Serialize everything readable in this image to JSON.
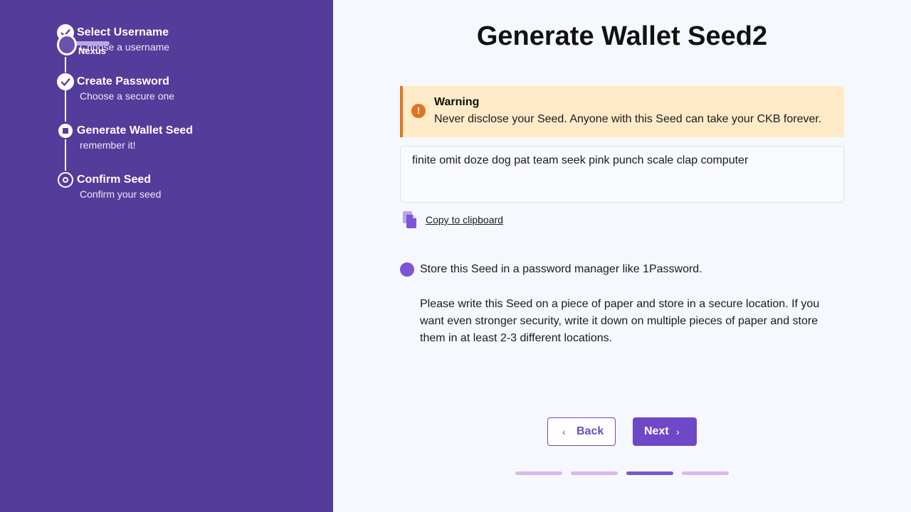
{
  "logo": {
    "word": "Nexus"
  },
  "steps": [
    {
      "title": "Select Username",
      "subtitle": "Choose a username",
      "state": "done"
    },
    {
      "title": "Create Password",
      "subtitle": "Choose a secure one",
      "state": "done"
    },
    {
      "title": "Generate Wallet Seed",
      "subtitle": "remember it!",
      "state": "current"
    },
    {
      "title": "Confirm Seed",
      "subtitle": "Confirm your seed",
      "state": "todo"
    }
  ],
  "main": {
    "title": "Generate Wallet Seed2",
    "warning": {
      "title": "Warning",
      "text": "Never disclose your Seed. Anyone with this Seed can take your CKB forever.",
      "icon": "!"
    },
    "seed": "finite omit doze dog pat team seek pink punch scale clap computer",
    "copy_label": "Copy to clipboard",
    "tip_password_manager": "Store this Seed in a password manager like 1Password.",
    "tip_paper": "Please write this Seed on a piece of paper and store in a secure location. If you want even stronger security, write it down on multiple pieces of paper and store them in at least 2-3 different locations."
  },
  "nav": {
    "back_label": "Back",
    "next_label": "Next",
    "back_icon": "‹",
    "next_icon": "›"
  },
  "progress": {
    "total": 4,
    "current": 3
  },
  "colors": {
    "sidebar": "#543c9a",
    "accent": "#6e48c6",
    "warning_bg": "#ffebc7",
    "warning_accent": "#e07426",
    "progress_inactive": "#d9b7f0"
  }
}
